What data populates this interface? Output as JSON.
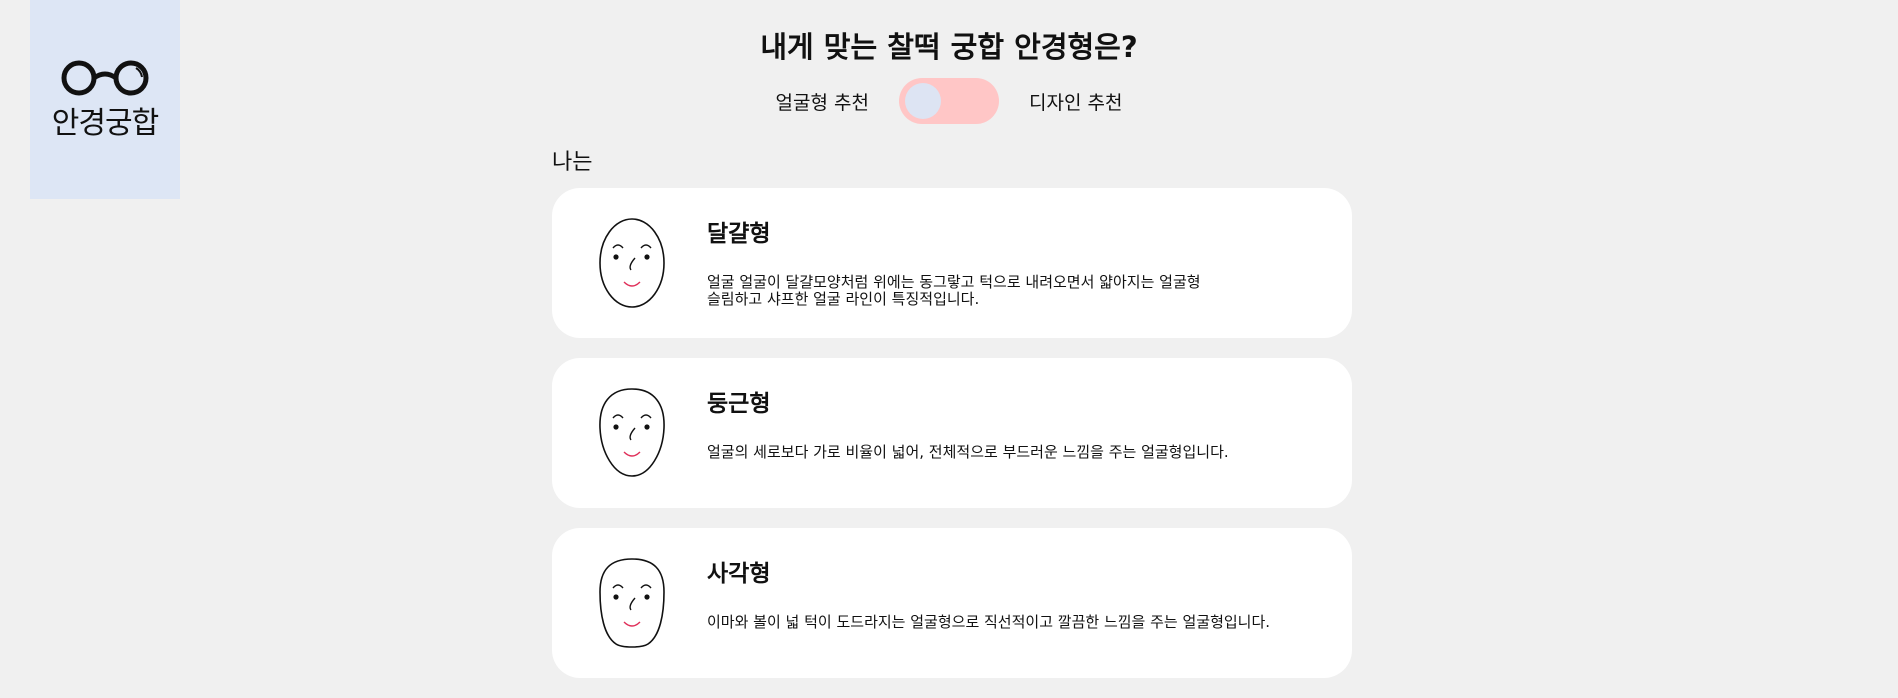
{
  "logo": {
    "text": "안경궁합",
    "icon": "glasses-icon"
  },
  "header": {
    "title": "내게 맞는 찰떡 궁합 안경형은?"
  },
  "toggle": {
    "left_label": "얼굴형 추천",
    "right_label": "디자인 추천",
    "state": "left",
    "track_color": "#ffc6c6",
    "knob_color": "#dde4f3"
  },
  "section": {
    "label": "나는"
  },
  "cards": [
    {
      "name": "달걀형",
      "description": "얼굴 얼굴이 달걀모양처럼 위에는 동그랗고 턱으로 내려오면서 얇아지는 얼굴형\n슬림하고 샤프한 얼굴 라인이 특징적입니다.",
      "icon": "oval-face-icon"
    },
    {
      "name": "둥근형",
      "description": "얼굴의 세로보다 가로 비율이 넓어, 전체적으로 부드러운 느낌을 주는 얼굴형입니다.",
      "icon": "round-face-icon"
    },
    {
      "name": "사각형",
      "description": "이마와 볼이 넓 턱이 도드라지는 얼굴형으로 직선적이고 깔끔한 느낌을 주는 얼굴형입니다.",
      "icon": "square-face-icon"
    }
  ],
  "colors": {
    "background": "#f0f0f0",
    "logo_background": "#dde6f5",
    "card_background": "#ffffff",
    "smile": "#e0305a"
  }
}
